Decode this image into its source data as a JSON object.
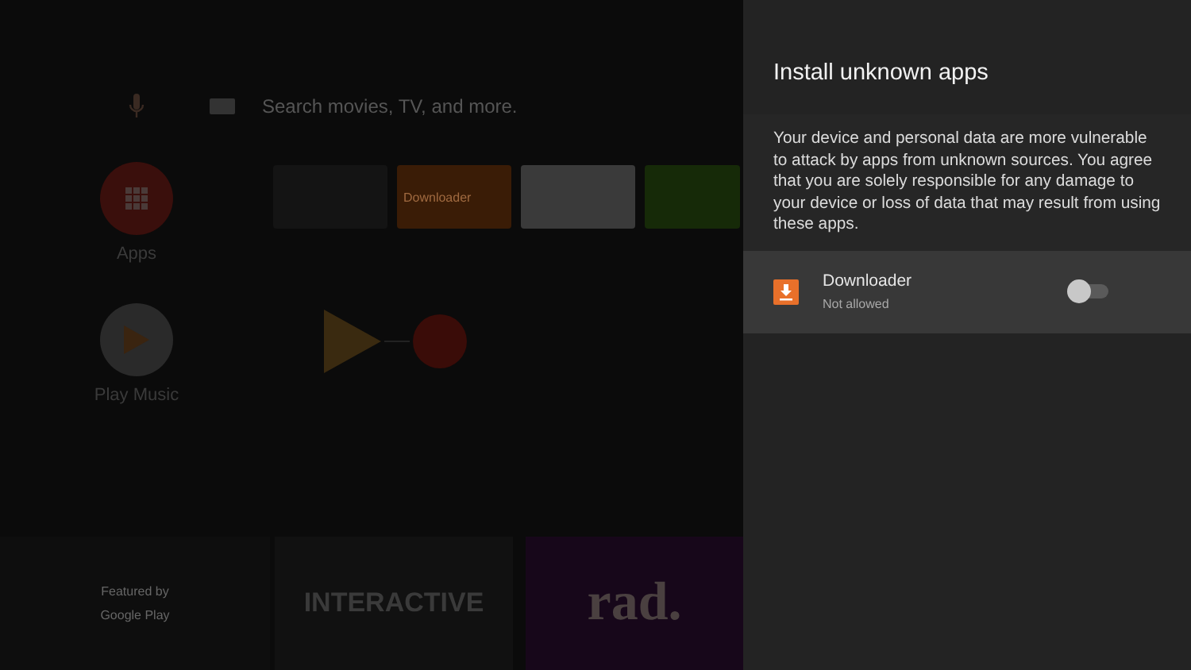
{
  "home": {
    "search": {
      "placeholder": "Search movies, TV, and more."
    },
    "rows": [
      {
        "label": "Apps",
        "kind": "apps",
        "tiles": [
          {
            "kind": "dark"
          },
          {
            "kind": "downloader",
            "label": "Downloader"
          },
          {
            "kind": "play-store"
          },
          {
            "kind": "nvidia"
          }
        ]
      },
      {
        "label": "Play Music",
        "kind": "music",
        "tiles": [
          {
            "kind": "music-pair"
          }
        ]
      }
    ],
    "featured": {
      "label": "Featured by",
      "source": "Google Play",
      "banners": [
        {
          "kind": "interactive",
          "label": "INTERACTIVE"
        },
        {
          "kind": "rad",
          "label": "rad."
        }
      ]
    }
  },
  "panel": {
    "title": "Install unknown apps",
    "description": "Your device and personal data are more vulnerable to attack by apps from unknown sources. You agree that you are solely responsible for any damage to your device or loss of data that may result from using these apps.",
    "apps": [
      {
        "name": "Downloader",
        "status": "Not allowed",
        "on": false,
        "selected": true
      }
    ]
  }
}
